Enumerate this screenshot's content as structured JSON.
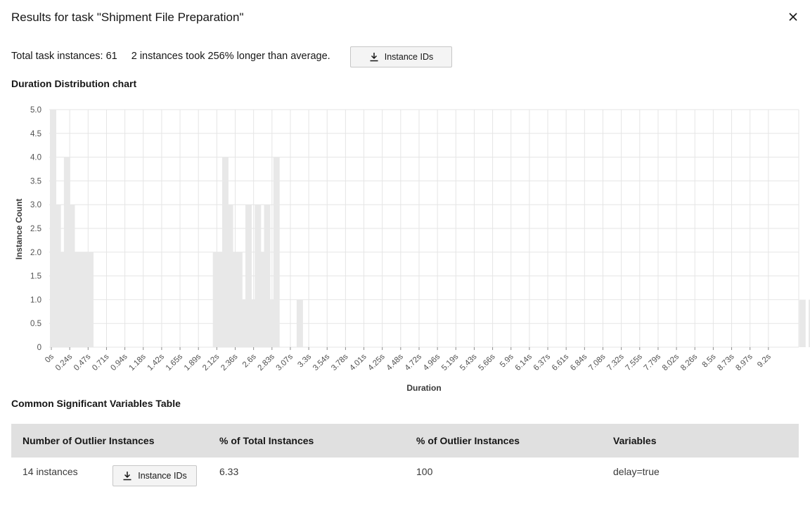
{
  "modal": {
    "title": "Results for task \"Shipment File Preparation\"",
    "close_icon": "close-icon"
  },
  "summary": {
    "total_label": "Total task instances: 61",
    "outlier_text": "2 instances took 256% longer than average.",
    "button_label": "Instance IDs",
    "button_icon": "download-icon"
  },
  "chart_section_title": "Duration Distribution chart",
  "chart_data": {
    "type": "bar",
    "xlabel": "Duration",
    "ylabel": "Instance Count",
    "ylim": [
      0,
      5
    ],
    "yticks": [
      "0",
      "0.5",
      "1.0",
      "1.5",
      "2.0",
      "2.5",
      "3.0",
      "3.5",
      "4.0",
      "4.5",
      "5.0"
    ],
    "grid": true,
    "tick_labels": [
      "0s",
      "0.24s",
      "0.47s",
      "0.71s",
      "0.94s",
      "1.18s",
      "1.42s",
      "1.65s",
      "1.89s",
      "2.12s",
      "2.36s",
      "2.6s",
      "2.83s",
      "3.07s",
      "3.3s",
      "3.54s",
      "3.78s",
      "4.01s",
      "4.25s",
      "4.48s",
      "4.72s",
      "4.96s",
      "5.19s",
      "5.43s",
      "5.66s",
      "5.9s",
      "6.14s",
      "6.37s",
      "6.61s",
      "6.84s",
      "7.08s",
      "7.32s",
      "7.55s",
      "7.79s",
      "8.02s",
      "8.26s",
      "8.5s",
      "8.73s",
      "8.97s",
      "9.2s"
    ],
    "values": [
      5,
      3,
      2,
      4,
      3,
      2,
      2,
      2,
      2,
      0,
      0,
      0,
      0,
      0,
      0,
      0,
      0,
      0,
      0,
      0,
      0,
      0,
      0,
      0,
      0,
      0,
      0,
      0,
      0,
      0,
      0,
      0,
      0,
      0,
      0,
      2,
      2,
      4,
      3,
      2,
      2,
      1,
      3,
      1,
      3,
      2,
      3,
      1,
      4,
      0,
      0,
      0,
      0,
      1,
      0,
      0,
      0,
      0,
      0,
      0,
      0,
      0,
      0,
      0,
      0,
      0,
      0,
      0,
      0,
      0,
      0,
      0,
      0,
      0,
      0,
      0,
      0,
      0,
      0,
      0,
      0,
      0,
      0,
      0,
      0,
      0,
      0,
      0,
      0,
      0,
      0,
      0,
      0,
      0,
      0,
      0,
      0,
      0,
      0,
      0,
      0,
      0,
      0,
      0,
      0,
      0,
      0,
      0,
      0,
      0,
      0,
      0,
      0,
      0,
      0,
      0,
      0,
      0,
      0,
      0,
      0,
      0,
      0,
      0,
      0,
      0,
      0,
      0,
      0,
      0,
      0,
      0,
      0,
      0,
      0,
      0,
      0,
      0,
      0,
      0,
      0,
      0,
      0,
      0,
      0,
      0,
      0,
      0,
      0,
      0,
      0,
      0,
      0,
      0,
      0,
      0,
      0,
      0,
      0,
      0,
      0,
      1,
      0,
      1
    ],
    "outlier_bars": [
      77,
      79
    ],
    "colors": {
      "normal": "#e8e8e8",
      "outlier": "#1f8ac7",
      "outlier_edge": "#0f62a6",
      "grid": "#e5e5e5"
    }
  },
  "table_section_title": "Common Significant Variables Table",
  "table": {
    "headers": [
      "Number of Outlier Instances",
      "% of Total Instances",
      "% of Outlier Instances",
      "Variables"
    ],
    "row": {
      "instances": "14 instances",
      "button_label": "Instance IDs",
      "pct_total": "6.33",
      "pct_outlier": "100",
      "variables": "delay=true"
    }
  }
}
